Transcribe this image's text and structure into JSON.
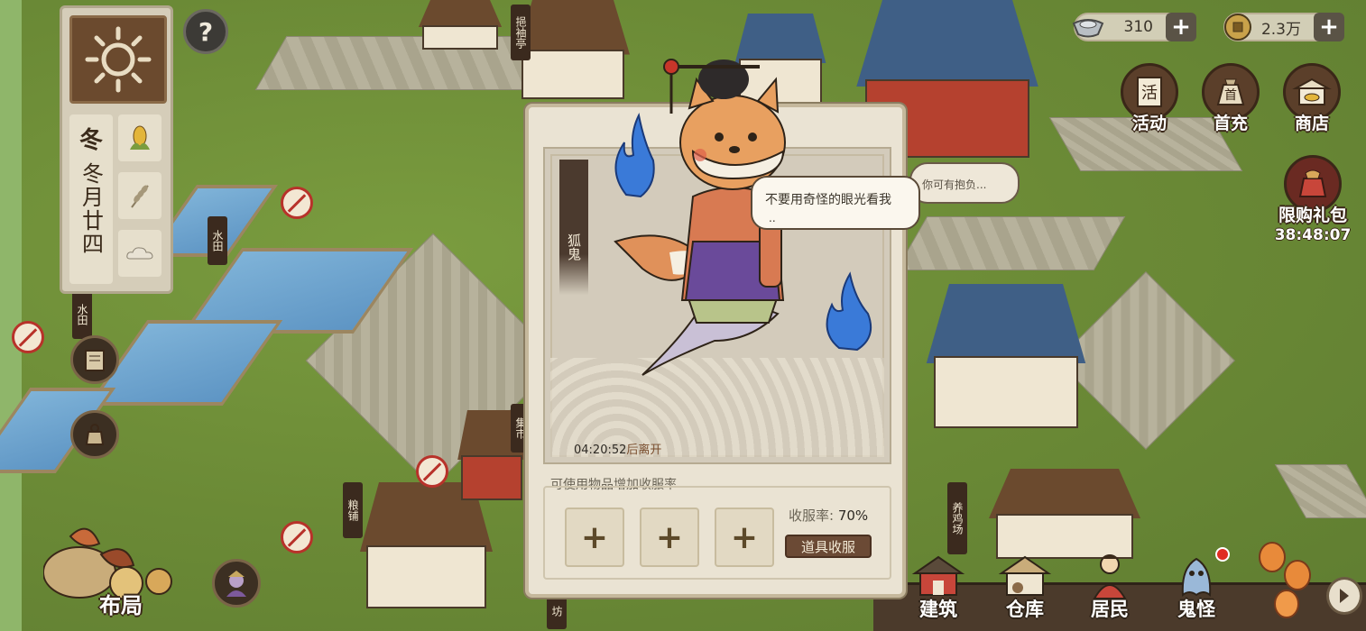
{
  "calendar": {
    "season": "冬",
    "date": "冬月廿四"
  },
  "signs": {
    "pavilion": "挹袖亭",
    "paddy1": "水田",
    "paddy2": "水田",
    "market": "集市",
    "grain_shop": "粮铺",
    "chicken_farm": "养鸡场",
    "workshop": "坊"
  },
  "currency": {
    "silver": "310",
    "coins": "2.3万"
  },
  "right_menu": {
    "activity": "活动",
    "first_recharge": "首充",
    "shop": "商店",
    "limited_pack": "限购礼包",
    "limited_timer": "38:48:07"
  },
  "bottom_nav": {
    "build": "建筑",
    "warehouse": "仓库",
    "residents": "居民",
    "ghosts": "鬼怪"
  },
  "layout_label": "布局",
  "dialog": {
    "ghost_name": "狐鬼",
    "leave_time": "04:20:52",
    "leave_suffix": "后离开",
    "items_title": "可使用物品增加收服率",
    "rate_label": "收服率:",
    "rate_value": "70%",
    "use_button": "道具收服",
    "slot_symbol": "+"
  },
  "speech": {
    "main": "不要用奇怪的眼光看我",
    "main_dots": "..",
    "npc": "你可有抱负..."
  },
  "help_symbol": "?",
  "colors": {
    "grass": "#6b8a36",
    "panel": "#eae3d3",
    "wood": "#6b4a35",
    "alert": "#e02c22"
  }
}
